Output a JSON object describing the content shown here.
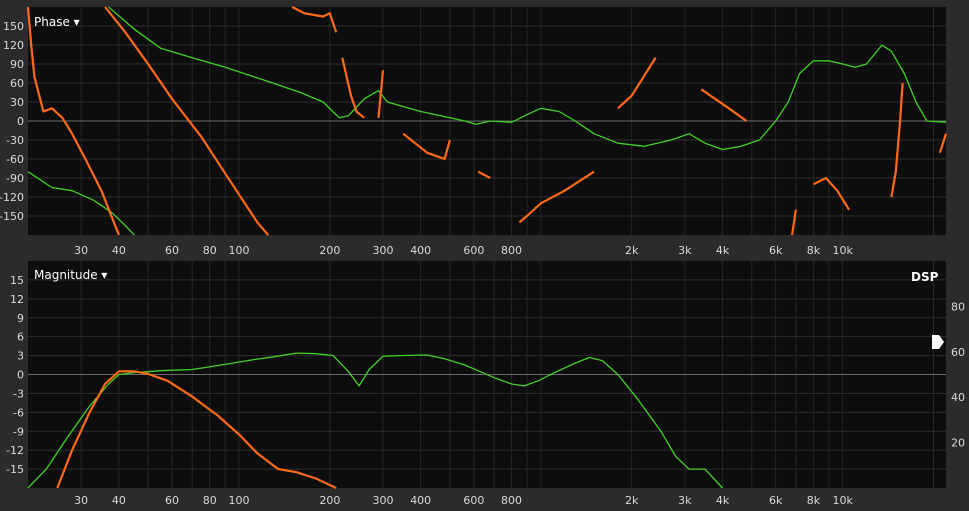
{
  "chart_data": [
    {
      "type": "line",
      "title": "Phase ▾",
      "x_scale": "log",
      "xlim": [
        20,
        22000
      ],
      "ylim": [
        -180,
        180
      ],
      "grid": true,
      "x_tick_labels": [
        "30",
        "40",
        "60",
        "80",
        "100",
        "200",
        "300",
        "400",
        "600",
        "800",
        "2k",
        "3k",
        "4k",
        "6k",
        "8k",
        "10k"
      ],
      "x_tick_values": [
        30,
        40,
        60,
        80,
        100,
        200,
        300,
        400,
        600,
        800,
        2000,
        3000,
        4000,
        6000,
        8000,
        10000
      ],
      "y_tick_labels": [
        "150",
        "120",
        "90",
        "60",
        "30",
        "0",
        "-30",
        "-60",
        "-90",
        "-120",
        "-150"
      ],
      "y_tick_values": [
        150,
        120,
        90,
        60,
        30,
        0,
        -30,
        -60,
        -90,
        -120,
        -150
      ],
      "series": [
        {
          "color": "#43d12a",
          "segments": [
            [
              [
                20,
                -80
              ],
              [
                24,
                -105
              ],
              [
                28,
                -110
              ],
              [
                33,
                -125
              ],
              [
                38,
                -145
              ],
              [
                42,
                -165
              ],
              [
                45,
                -180
              ]
            ],
            [
              [
                37,
                180
              ],
              [
                45,
                145
              ],
              [
                55,
                115
              ],
              [
                70,
                100
              ],
              [
                90,
                85
              ],
              [
                120,
                65
              ],
              [
                160,
                45
              ],
              [
                190,
                30
              ],
              [
                215,
                5
              ],
              [
                230,
                8
              ],
              [
                260,
                35
              ],
              [
                290,
                48
              ],
              [
                310,
                30
              ],
              [
                400,
                15
              ],
              [
                500,
                5
              ],
              [
                560,
                0
              ],
              [
                610,
                -5
              ],
              [
                680,
                0
              ],
              [
                800,
                -2
              ],
              [
                900,
                10
              ],
              [
                1000,
                20
              ],
              [
                1150,
                15
              ],
              [
                1300,
                0
              ],
              [
                1500,
                -20
              ],
              [
                1800,
                -35
              ],
              [
                2200,
                -40
              ],
              [
                2700,
                -30
              ],
              [
                3100,
                -20
              ],
              [
                3500,
                -35
              ],
              [
                4000,
                -45
              ],
              [
                4600,
                -40
              ],
              [
                5300,
                -30
              ],
              [
                6000,
                0
              ],
              [
                6600,
                30
              ],
              [
                7200,
                75
              ],
              [
                8000,
                95
              ],
              [
                9000,
                95
              ],
              [
                10000,
                90
              ],
              [
                11000,
                85
              ],
              [
                12000,
                90
              ],
              [
                13500,
                120
              ],
              [
                14500,
                110
              ],
              [
                16000,
                75
              ],
              [
                17500,
                30
              ],
              [
                19000,
                0
              ],
              [
                22000,
                -2
              ]
            ]
          ]
        },
        {
          "color": "#ff6a1a",
          "segments": [
            [
              [
                20,
                180
              ],
              [
                20.5,
                120
              ],
              [
                21,
                70
              ],
              [
                22.5,
                15
              ],
              [
                24,
                20
              ],
              [
                26,
                5
              ],
              [
                28,
                -20
              ],
              [
                31,
                -60
              ],
              [
                35,
                -110
              ],
              [
                40,
                -180
              ]
            ],
            [
              [
                36,
                180
              ],
              [
                42,
                140
              ],
              [
                50,
                90
              ],
              [
                60,
                35
              ],
              [
                75,
                -25
              ],
              [
                95,
                -100
              ],
              [
                115,
                -160
              ],
              [
                125,
                -180
              ]
            ],
            [
              [
                150,
                180
              ],
              [
                165,
                170
              ],
              [
                190,
                165
              ],
              [
                200,
                170
              ],
              [
                210,
                140
              ]
            ],
            [
              [
                220,
                100
              ],
              [
                235,
                40
              ],
              [
                245,
                15
              ],
              [
                260,
                5
              ]
            ],
            [
              [
                290,
                5
              ],
              [
                300,
                80
              ]
            ],
            [
              [
                350,
                -20
              ],
              [
                420,
                -50
              ],
              [
                480,
                -60
              ],
              [
                500,
                -30
              ]
            ],
            [
              [
                620,
                -80
              ],
              [
                680,
                -90
              ]
            ],
            [
              [
                850,
                -160
              ],
              [
                900,
                -150
              ],
              [
                1000,
                -130
              ],
              [
                1200,
                -110
              ],
              [
                1500,
                -80
              ]
            ],
            [
              [
                1800,
                20
              ],
              [
                2000,
                40
              ],
              [
                2400,
                100
              ]
            ],
            [
              [
                3400,
                50
              ],
              [
                4200,
                20
              ],
              [
                4800,
                0
              ]
            ],
            [
              [
                6800,
                -180
              ],
              [
                7000,
                -140
              ]
            ],
            [
              [
                8000,
                -100
              ],
              [
                8800,
                -90
              ],
              [
                9600,
                -110
              ],
              [
                10500,
                -140
              ]
            ],
            [
              [
                14500,
                -120
              ],
              [
                15000,
                -80
              ],
              [
                15500,
                0
              ],
              [
                15800,
                60
              ]
            ],
            [
              [
                21000,
                -50
              ],
              [
                22000,
                -20
              ]
            ]
          ]
        }
      ]
    },
    {
      "type": "line",
      "title": "Magnitude ▾",
      "x_scale": "log",
      "xlim": [
        20,
        22000
      ],
      "ylim": [
        -18,
        18
      ],
      "grid": true,
      "x_tick_labels": [
        "30",
        "40",
        "60",
        "80",
        "100",
        "200",
        "300",
        "400",
        "600",
        "800",
        "2k",
        "3k",
        "4k",
        "6k",
        "8k",
        "10k"
      ],
      "x_tick_values": [
        30,
        40,
        60,
        80,
        100,
        200,
        300,
        400,
        600,
        800,
        2000,
        3000,
        4000,
        6000,
        8000,
        10000
      ],
      "y_tick_labels": [
        "15",
        "12",
        "9",
        "6",
        "3",
        "0",
        "-3",
        "-6",
        "-9",
        "-12",
        "-15"
      ],
      "y_tick_values": [
        15,
        12,
        9,
        6,
        3,
        0,
        -3,
        -6,
        -9,
        -12,
        -15
      ],
      "y2_tick_labels": [
        "80",
        "60",
        "40",
        "20"
      ],
      "y2_tick_values": [
        80,
        60,
        40,
        20
      ],
      "y2lim": [
        0,
        100
      ],
      "y2_label": "DSP",
      "series": [
        {
          "color": "#43d12a",
          "segments": [
            [
              [
                20,
                -18
              ],
              [
                23,
                -15
              ],
              [
                27,
                -10
              ],
              [
                32,
                -5
              ],
              [
                37,
                -1.5
              ],
              [
                40,
                0
              ],
              [
                45,
                0.3
              ],
              [
                55,
                0.6
              ],
              [
                70,
                0.8
              ],
              [
                90,
                1.6
              ],
              [
                110,
                2.3
              ],
              [
                130,
                2.8
              ],
              [
                155,
                3.4
              ],
              [
                180,
                3.3
              ],
              [
                205,
                3.0
              ],
              [
                230,
                0.5
              ],
              [
                250,
                -1.8
              ],
              [
                270,
                0.8
              ],
              [
                300,
                2.9
              ],
              [
                340,
                3.0
              ],
              [
                420,
                3.1
              ],
              [
                480,
                2.5
              ],
              [
                560,
                1.5
              ],
              [
                620,
                0.6
              ],
              [
                700,
                -0.5
              ],
              [
                800,
                -1.5
              ],
              [
                880,
                -1.8
              ],
              [
                980,
                -1.0
              ],
              [
                1100,
                0.2
              ],
              [
                1300,
                1.8
              ],
              [
                1450,
                2.7
              ],
              [
                1600,
                2.2
              ],
              [
                1800,
                0
              ],
              [
                2100,
                -4
              ],
              [
                2500,
                -9
              ],
              [
                2800,
                -13
              ],
              [
                3100,
                -15
              ],
              [
                3500,
                -15
              ],
              [
                4000,
                -18
              ]
            ]
          ]
        },
        {
          "color": "#ff6a1a",
          "segments": [
            [
              [
                25,
                -18
              ],
              [
                28,
                -12
              ],
              [
                32,
                -6
              ],
              [
                36,
                -1.5
              ],
              [
                40,
                0.5
              ],
              [
                45,
                0.5
              ],
              [
                50,
                0.1
              ],
              [
                58,
                -1
              ],
              [
                70,
                -3.5
              ],
              [
                85,
                -6.5
              ],
              [
                100,
                -9.5
              ],
              [
                115,
                -12.5
              ],
              [
                135,
                -15
              ],
              [
                155,
                -15.5
              ],
              [
                180,
                -16.5
              ],
              [
                210,
                -18
              ]
            ]
          ]
        }
      ]
    }
  ]
}
